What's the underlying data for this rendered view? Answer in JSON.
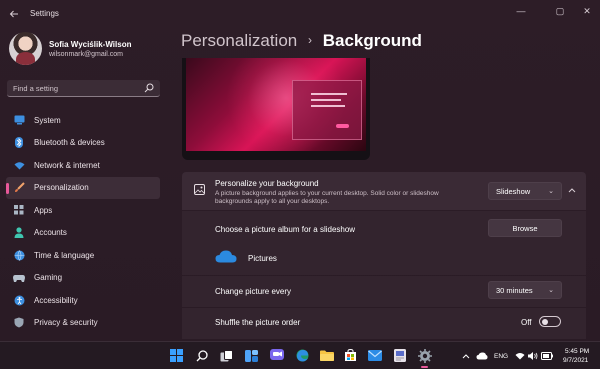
{
  "window": {
    "title": "Settings",
    "controls": {
      "minimize": "—",
      "maximize": "▢",
      "close": "✕"
    }
  },
  "profile": {
    "name": "Sofia Wyciślik-Wilson",
    "email": "wilsonmark@gmail.com"
  },
  "search": {
    "placeholder": "Find a setting"
  },
  "nav": {
    "items": [
      {
        "label": "System",
        "icon": "monitor-icon",
        "active": false
      },
      {
        "label": "Bluetooth & devices",
        "icon": "bluetooth-icon",
        "active": false
      },
      {
        "label": "Network & internet",
        "icon": "wifi-icon",
        "active": false
      },
      {
        "label": "Personalization",
        "icon": "brush-icon",
        "active": true
      },
      {
        "label": "Apps",
        "icon": "apps-icon",
        "active": false
      },
      {
        "label": "Accounts",
        "icon": "person-icon",
        "active": false
      },
      {
        "label": "Time & language",
        "icon": "globe-icon",
        "active": false
      },
      {
        "label": "Gaming",
        "icon": "gamepad-icon",
        "active": false
      },
      {
        "label": "Accessibility",
        "icon": "accessibility-icon",
        "active": false
      },
      {
        "label": "Privacy & security",
        "icon": "shield-icon",
        "active": false
      }
    ]
  },
  "header": {
    "parent": "Personalization",
    "separator": "›",
    "current": "Background"
  },
  "background": {
    "personalize_title": "Personalize your background",
    "personalize_desc_line1": "A picture background applies to your current desktop. Solid color or slideshow",
    "personalize_desc_line2": "backgrounds apply to all your desktops.",
    "type_value": "Slideshow",
    "album_label": "Choose a picture album for a slideshow",
    "browse_label": "Browse",
    "album_name": "Pictures",
    "change_label": "Change picture every",
    "change_value": "30 minutes",
    "shuffle_label": "Shuffle the picture order",
    "shuffle_state": "Off"
  },
  "taskbar": {
    "lang": "ENG",
    "time": "5:45 PM",
    "date": "9/7/2021"
  },
  "colors": {
    "accent": "#e8589a",
    "background": "#2a1c25",
    "card": "#3a2a35"
  }
}
